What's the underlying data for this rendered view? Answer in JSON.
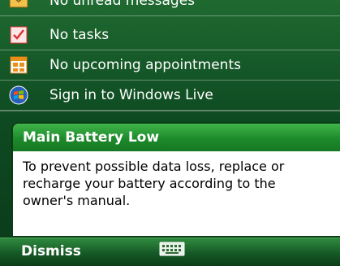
{
  "today": {
    "items": [
      {
        "label": "No unread messages",
        "icon": "envelope-icon"
      },
      {
        "label": "No tasks",
        "icon": "task-checkbox-icon"
      },
      {
        "label": "No upcoming appointments",
        "icon": "calendar-icon"
      },
      {
        "label": "Sign in to Windows Live",
        "icon": "windows-live-icon"
      }
    ]
  },
  "dialog": {
    "title": "Main Battery Low",
    "message_lines": [
      "To prevent possible data loss, replace or",
      "recharge your battery according to the",
      "owner's manual."
    ]
  },
  "softkeys": {
    "left_label": "Dismiss",
    "center_icon": "keyboard-icon"
  }
}
